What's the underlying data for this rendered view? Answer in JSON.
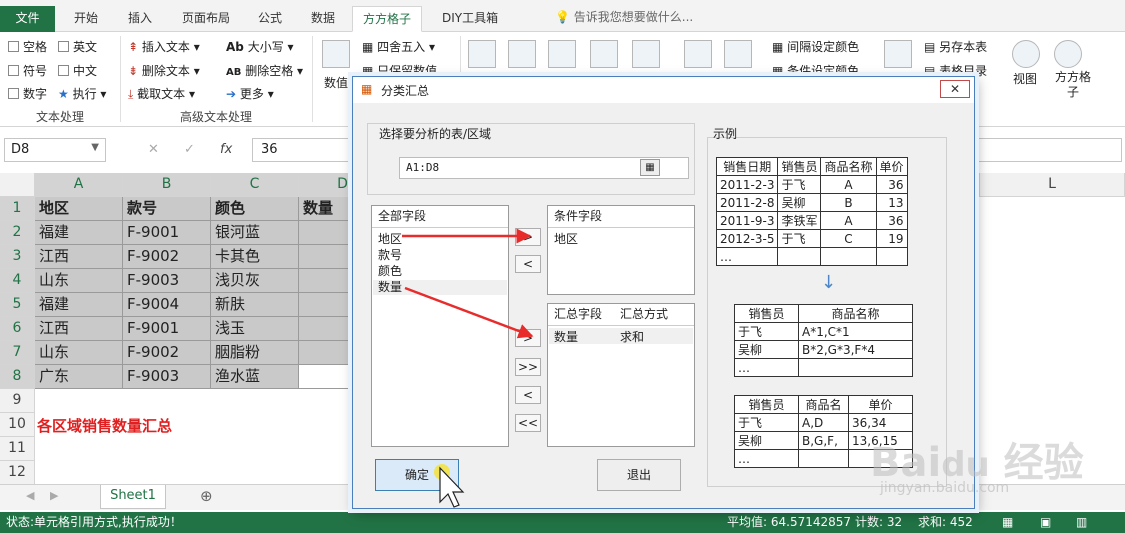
{
  "ribbon": {
    "tabs": [
      "文件",
      "开始",
      "插入",
      "页面布局",
      "公式",
      "数据",
      "方方格子",
      "DIY工具箱"
    ],
    "active_tab": "方方格子",
    "tellme": "告诉我您想要做什么...",
    "text_processing": {
      "items": [
        "空格",
        "英文",
        "符号",
        "中文",
        "数字",
        "执行"
      ],
      "group_label": "文本处理"
    },
    "advanced_text": {
      "items": [
        "插入文本",
        "删除文本",
        "截取文本",
        "大小写",
        "删除空格",
        "更多"
      ],
      "group_label": "高级文本处理"
    },
    "right_items": [
      "数值",
      "四舍五入",
      "只保留数值",
      "间隔设定颜色",
      "条件设定颜色",
      "另存本表",
      "表格目录",
      "视图",
      "方方格子"
    ]
  },
  "formula_bar": {
    "name_box": "D8",
    "value": "36"
  },
  "grid": {
    "columns": [
      "A",
      "B",
      "C",
      "D",
      "L"
    ],
    "rows": [
      "1",
      "2",
      "3",
      "4",
      "5",
      "6",
      "7",
      "8",
      "9",
      "10",
      "11",
      "12"
    ],
    "data": [
      [
        "地区",
        "款号",
        "颜色",
        "数量"
      ],
      [
        "福建",
        "F-9001",
        "银河蓝",
        ""
      ],
      [
        "江西",
        "F-9002",
        "卡其色",
        ""
      ],
      [
        "山东",
        "F-9003",
        "浅贝灰",
        ""
      ],
      [
        "福建",
        "F-9004",
        "新肤",
        ""
      ],
      [
        "江西",
        "F-9001",
        "浅玉",
        ""
      ],
      [
        "山东",
        "F-9002",
        "胭脂粉",
        ""
      ],
      [
        "广东",
        "F-9003",
        "渔水蓝",
        ""
      ]
    ],
    "note": "各区域销售数量汇总"
  },
  "sheet_tab": "Sheet1",
  "status": {
    "message": "状态:单元格引用方式,执行成功！",
    "average": "平均值: 64.57142857",
    "count": "计数: 32",
    "sum": "求和: 452"
  },
  "dialog": {
    "title": "分类汇总",
    "close": "✕",
    "range_label": "选择要分析的表/区域",
    "range_value": "A1:D8",
    "all_fields_label": "全部字段",
    "all_fields": [
      "地区",
      "款号",
      "颜色",
      "数量"
    ],
    "cond_fields_label": "条件字段",
    "cond_fields": [
      "地区"
    ],
    "sum_field_label": "汇总字段",
    "sum_method_label": "汇总方式",
    "sum_rows": [
      {
        "field": "数量",
        "method": "求和"
      }
    ],
    "btn_add": ">",
    "btn_remove": "<",
    "btn_add_all": ">>",
    "btn_remove_all": "<<",
    "ok": "确定",
    "exit": "退出",
    "example_label": "示例",
    "example_source": {
      "headers": [
        "销售日期",
        "销售员",
        "商品名称",
        "单价"
      ],
      "rows": [
        [
          "2011-2-3",
          "于飞",
          "A",
          "36"
        ],
        [
          "2011-2-8",
          "吴柳",
          "B",
          "13"
        ],
        [
          "2011-9-3",
          "李铁军",
          "A",
          "36"
        ],
        [
          "2012-3-5",
          "于飞",
          "C",
          "19"
        ],
        [
          "…",
          "",
          "",
          ""
        ]
      ]
    },
    "example_result1": {
      "headers": [
        "销售员",
        "商品名称"
      ],
      "rows": [
        [
          "于飞",
          "A*1,C*1"
        ],
        [
          "吴柳",
          "B*2,G*3,F*4"
        ],
        [
          "…",
          ""
        ]
      ]
    },
    "example_result2": {
      "headers": [
        "销售员",
        "商品名",
        "单价"
      ],
      "rows": [
        [
          "于飞",
          "A,D",
          "36,34"
        ],
        [
          "吴柳",
          "B,G,F,",
          "13,6,15"
        ],
        [
          "…",
          "",
          ""
        ]
      ]
    }
  },
  "watermark": {
    "brand": "Baidu经验",
    "url": "jingyan.baidu.com"
  }
}
